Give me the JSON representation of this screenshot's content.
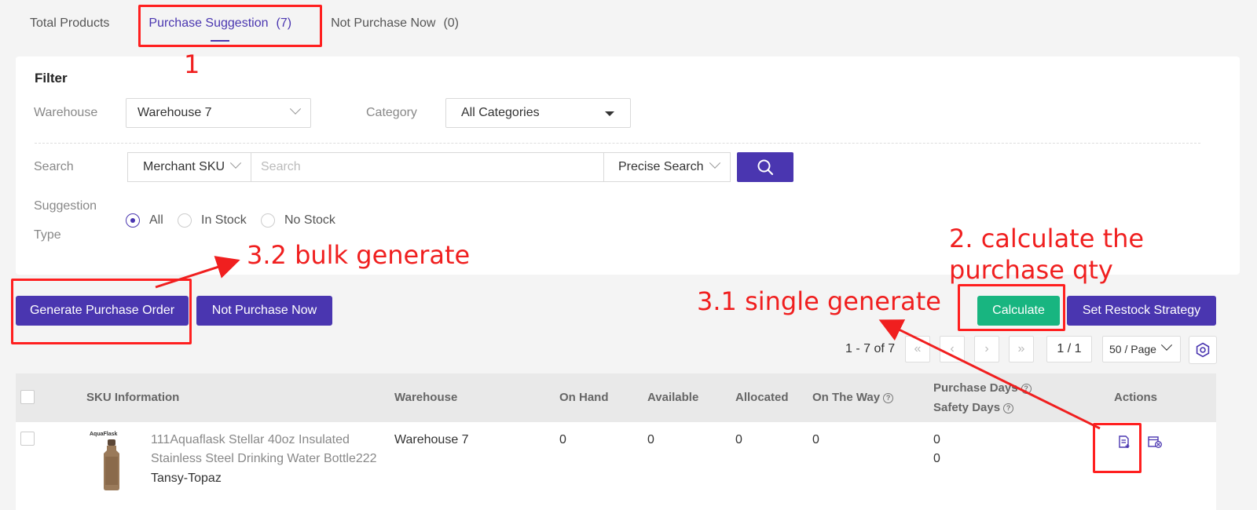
{
  "tabs": [
    {
      "label": "Total Products",
      "count": ""
    },
    {
      "label": "Purchase Suggestion",
      "count": "(7)"
    },
    {
      "label": "Not Purchase Now",
      "count": "(0)"
    }
  ],
  "filter": {
    "title": "Filter",
    "warehouse_label": "Warehouse",
    "warehouse_value": "Warehouse 7",
    "category_label": "Category",
    "category_value": "All Categories",
    "search_label": "Search",
    "search_field": "Merchant SKU",
    "search_placeholder": "Search",
    "search_mode": "Precise Search",
    "suggestion_label_1": "Suggestion",
    "suggestion_label_2": "Type",
    "radios": [
      "All",
      "In Stock",
      "No Stock"
    ]
  },
  "actions": {
    "generate": "Generate Purchase Order",
    "not_purchase": "Not Purchase Now",
    "calculate": "Calculate",
    "restock": "Set Restock Strategy"
  },
  "pagination": {
    "summary": "1 - 7 of 7",
    "page": "1 / 1",
    "page_size": "50 / Page"
  },
  "table": {
    "headers": {
      "sku": "SKU Information",
      "warehouse": "Warehouse",
      "on_hand": "On Hand",
      "available": "Available",
      "allocated": "Allocated",
      "on_the_way": "On The Way",
      "purchase_days": "Purchase Days",
      "safety_days": "Safety Days",
      "actions": "Actions"
    },
    "rows": [
      {
        "brand": "AquaFlask",
        "name_line1": "111Aquaflask Stellar 40oz Insulated",
        "name_line2": "Stainless Steel Drinking Water Bottle222",
        "variant": "Tansy-Topaz",
        "warehouse": "Warehouse 7",
        "on_hand": "0",
        "available": "0",
        "allocated": "0",
        "on_the_way": "0",
        "purchase_days": "0",
        "safety_days": "0"
      }
    ]
  },
  "annotations": {
    "a1": "1",
    "a2_line1": "2. calculate the",
    "a2_line2": "purchase qty",
    "a31": "3.1 single generate",
    "a32": "3.2 bulk generate"
  },
  "colors": {
    "primary": "#4a36b0",
    "success": "#18b580",
    "annotation": "#f01f1f"
  }
}
